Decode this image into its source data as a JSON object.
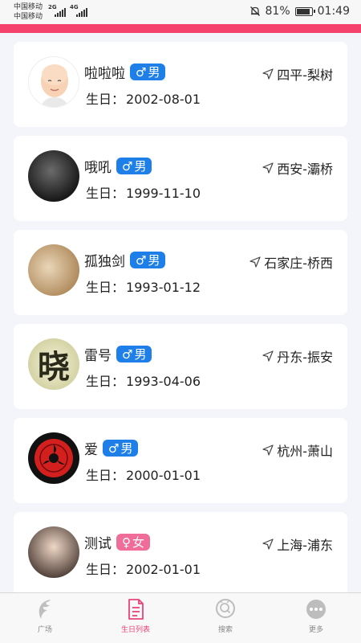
{
  "status_bar": {
    "carrier1": "中国移动",
    "carrier2": "中国移动",
    "net1": "2G",
    "net2": "4G",
    "battery": "81%",
    "time": "01:49"
  },
  "users": [
    {
      "name": "啦啦啦",
      "gender": "男",
      "gender_symbol": "♂",
      "location": "四平-梨树",
      "birthday_label": "生日：",
      "birthday": "2002-08-01"
    },
    {
      "name": "哦吼",
      "gender": "男",
      "gender_symbol": "♂",
      "location": "西安-灞桥",
      "birthday_label": "生日：",
      "birthday": "1999-11-10"
    },
    {
      "name": "孤独剑",
      "gender": "男",
      "gender_symbol": "♂",
      "location": "石家庄-桥西",
      "birthday_label": "生日：",
      "birthday": "1993-01-12"
    },
    {
      "name": "雷号",
      "gender": "男",
      "gender_symbol": "♂",
      "location": "丹东-振安",
      "birthday_label": "生日：",
      "birthday": "1993-04-06",
      "avatar_text": "晓"
    },
    {
      "name": "爱",
      "gender": "男",
      "gender_symbol": "♂",
      "location": "杭州-萧山",
      "birthday_label": "生日：",
      "birthday": "2000-01-01"
    },
    {
      "name": "测试",
      "gender": "女",
      "gender_symbol": "♀",
      "location": "上海-浦东",
      "birthday_label": "生日：",
      "birthday": "2002-01-01"
    }
  ],
  "tabs": [
    {
      "label": "广场",
      "icon": "wing-icon",
      "active": false
    },
    {
      "label": "生日列表",
      "icon": "document-icon",
      "active": true
    },
    {
      "label": "搜索",
      "icon": "search-icon",
      "active": false
    },
    {
      "label": "更多",
      "icon": "more-icon",
      "active": false
    }
  ],
  "colors": {
    "accent": "#f5426c",
    "male_badge": "#1e7fe8",
    "female_badge": "#ef6d98",
    "active_tab": "#e8437a"
  }
}
